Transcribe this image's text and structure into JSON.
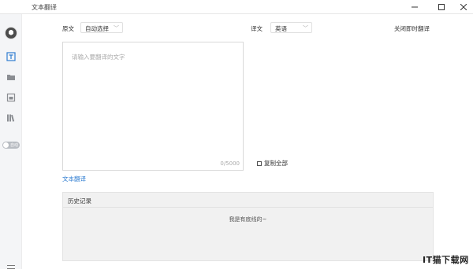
{
  "window": {
    "title": "文本翻译",
    "controls": [
      "minimize",
      "maximize",
      "close"
    ]
  },
  "sidebar": {
    "items": [
      {
        "icon": "avatar"
      },
      {
        "icon": "text-translate-icon",
        "active": true
      },
      {
        "icon": "folder-icon"
      },
      {
        "icon": "image-icon"
      },
      {
        "icon": "library-icon"
      }
    ],
    "toggle_label": "自动"
  },
  "source": {
    "label": "原文",
    "selected": "自动选择"
  },
  "target": {
    "label": "译文",
    "selected": "英语"
  },
  "close_instant": "关闭即时翻译",
  "input": {
    "placeholder": "请输入要翻译的文字",
    "counter": "0/5000"
  },
  "copy_all": "复制全部",
  "translate_link": "文本翻译",
  "history": {
    "title": "历史记录",
    "empty_text": "我是有底线的~"
  },
  "watermark": "IT猫下载网",
  "colors": {
    "accent": "#2f7dd1",
    "sidebar_bg": "#f4f5f7",
    "history_bg": "#f1f1f1"
  }
}
